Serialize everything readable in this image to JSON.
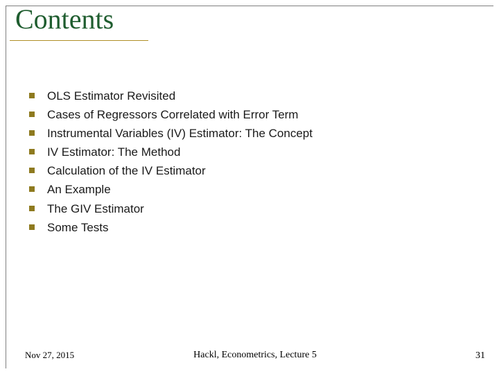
{
  "title": "Contents",
  "items": [
    "OLS Estimator Revisited",
    "Cases of Regressors Correlated with Error Term",
    "Instrumental Variables (IV) Estimator: The Concept",
    "IV Estimator: The Method",
    "Calculation of the IV Estimator",
    "An Example",
    "The GIV Estimator",
    "Some Tests"
  ],
  "footer": {
    "date": "Nov 27, 2015",
    "center": "Hackl,  Econometrics, Lecture 5",
    "page": "31"
  }
}
